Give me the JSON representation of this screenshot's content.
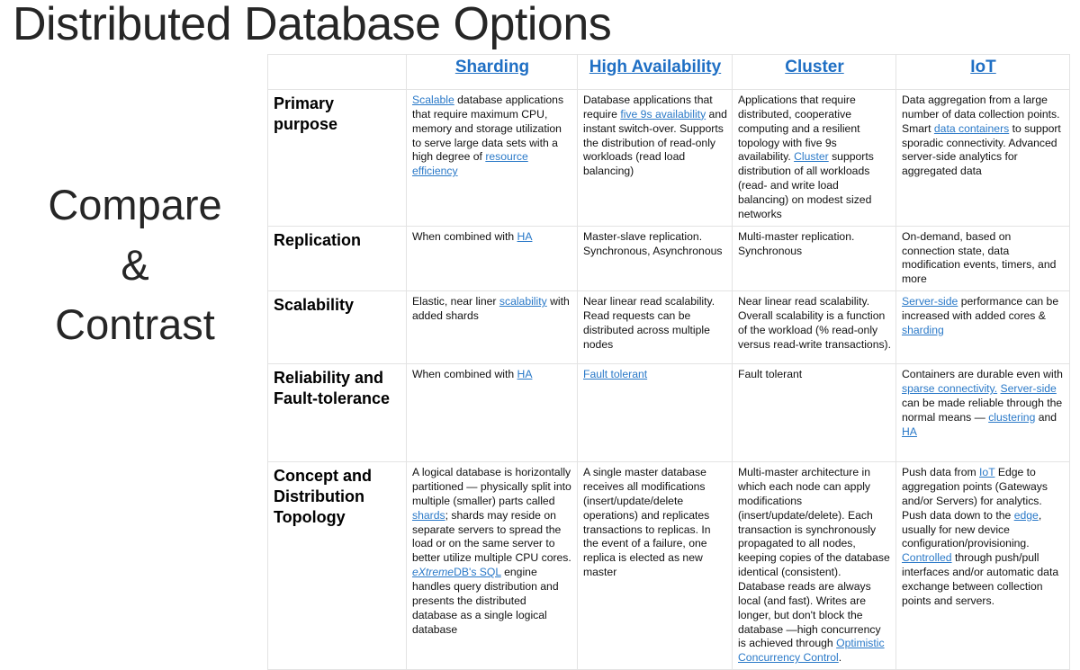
{
  "slide": {
    "title": "Distributed Database Options",
    "caption_lines": [
      "Compare",
      "&",
      "Contrast"
    ],
    "accent_color": "#2a79c8",
    "header_color": "#1f6fc4",
    "text_color": "#111111",
    "border_color": "#e3e3e3"
  },
  "table": {
    "corner_label": "",
    "columns": [
      {
        "key": "sharding",
        "label": "Sharding ",
        "link": true
      },
      {
        "key": "high_availability",
        "label": "High Availability",
        "link": true
      },
      {
        "key": "cluster",
        "label": "Cluster",
        "link": true
      },
      {
        "key": "iot",
        "label": "IoT",
        "link": true
      }
    ],
    "rows": [
      {
        "label": "Primary purpose",
        "cells": {
          "sharding": "Scalable database applications that require maximum CPU, memory and storage utilization to serve large data sets with a high degree of resource efficiency",
          "high_availability": "Database applications that require five 9s availability and instant switch-over. Supports the distribution of read-only workloads (read load balancing)",
          "cluster": "Applications that require distributed, cooperative computing and a resilient topology with five 9s availability. Cluster supports distribution of all workloads (read- and write load balancing) on modest sized networks",
          "iot": "Data aggregation from a large number of data collection points. Smart data containers to support sporadic connectivity. Advanced server-side analytics for aggregated data"
        },
        "links": {
          "sharding": [
            "Scalable",
            "resource efficiency"
          ],
          "high_availability": [
            "five 9s availability"
          ],
          "cluster": [
            "Cluster"
          ],
          "iot": [
            "data containers"
          ]
        }
      },
      {
        "label": "Replication",
        "cells": {
          "sharding": "When combined with HA",
          "high_availability": "Master-slave replication. Synchronous, Asynchronous",
          "cluster": "Multi-master replication. Synchronous",
          "iot": "On-demand, based on connection state, data modification events, timers, and more"
        },
        "links": {
          "sharding": [
            "HA"
          ],
          "high_availability": [],
          "cluster": [],
          "iot": []
        }
      },
      {
        "label": "Scalability",
        "cells": {
          "sharding": "Elastic, near liner scalability with added shards",
          "high_availability": "Near linear read scalability. Read requests can be distributed across multiple nodes",
          "cluster": "Near linear read scalability. Overall scalability is a function of the workload (% read-only versus read-write transactions).",
          "iot": "Server-side performance can be increased with added cores & sharding"
        },
        "links": {
          "sharding": [
            "scalability"
          ],
          "high_availability": [],
          "cluster": [],
          "iot": [
            "Server-side",
            "sharding"
          ]
        }
      },
      {
        "label": "Reliability and Fault-tolerance",
        "cells": {
          "sharding": "When combined with HA",
          "high_availability": "Fault tolerant ",
          "cluster": "Fault tolerant",
          "iot": "Containers are durable even with sparse connectivity. Server-side can be made reliable through the normal means — clustering and HA"
        },
        "links": {
          "sharding": [
            "HA"
          ],
          "high_availability": [
            "Fault tolerant "
          ],
          "cluster": [],
          "iot": [
            "sparse connectivity.",
            "Server-side",
            "clustering",
            "HA"
          ]
        }
      },
      {
        "label": "Concept and Distribution Topology",
        "cells": {
          "sharding": "A logical database is horizontally partitioned — physically split into multiple (smaller) parts called shards; shards may reside on separate servers to spread the load or on the same server to better utilize multiple CPU cores. eXtremeDB's SQL engine handles query distribution and presents the distributed database as a single logical database",
          "high_availability": "A single master database receives all modifications (insert/update/delete operations) and replicates transactions to replicas. In the event of a failure, one replica is elected as new master",
          "cluster": "Multi-master architecture in which each node can apply modifications (insert/update/delete). Each transaction is synchronously propagated to all nodes, keeping copies of the database identical (consistent). Database reads are always local (and fast). Writes are longer, but don't block the database —high concurrency is achieved through Optimistic Concurrency Control.",
          "iot": "Push data from IoT Edge to aggregation points (Gateways and/or Servers) for analytics. Push data down to the edge, usually for new device configuration/provisioning. Controlled through push/pull interfaces and/or automatic data exchange between collection points and servers."
        },
        "links": {
          "sharding": [
            "shards",
            "eXtremeDB's SQL"
          ],
          "high_availability": [],
          "cluster": [
            "Optimistic Concurrency Control"
          ],
          "iot": [
            "IoT",
            "edge",
            "Controlled"
          ]
        }
      }
    ]
  }
}
